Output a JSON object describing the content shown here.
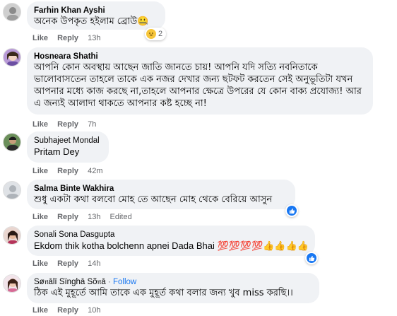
{
  "actions": {
    "like": "Like",
    "reply": "Reply"
  },
  "comments": [
    {
      "author": "Farhin Khan Ayshi",
      "text": "অনেক উপকৃত হইলাম ব্রোউ🤐",
      "time": "13h",
      "reaction_count": "2"
    },
    {
      "author": "Hosneara Shathi",
      "text": "আপনি কোন অবস্থায় আছেন জাতি জানতে চায়! আপনি যদি সত্যি নবনিতাকে ভালোবাসতেন তাহলে তাকে এক নজর দেখার জন্য ছটফট করতেন সেই অনুভূতিটা যখন আপনার মধ্যে কাজ করছে না,তাহলে আপনার ক্ষেত্রে উপরের যে কোন বাক্য প্রযোজ্য! আর এ জন্যই আলাদা থাকতে আপনার কষ্ট হচ্ছে না!",
      "time": "7h"
    },
    {
      "author": "Subhajeet Mondal",
      "text": "Pritam Dey",
      "time": "42m"
    },
    {
      "author": "Salma Binte Wakhira",
      "text": "শুধু একটা কথা বলবো মোহ তে আছেন মোহ থেকে বেরিয়ে আসুন",
      "time": "13h",
      "edited": "Edited"
    },
    {
      "author": "Sonali Sona Dasgupta",
      "text": "Ekdom thik kotha bolchenn apnei Dada Bhai 💯💯💯💯👍👍👍👍",
      "time": "14h"
    },
    {
      "author": "Sø𝔫ālī Sïnghā Sõ𝔫ā",
      "follow": "Follow",
      "text": "ঠিক এই মুহূর্তে আমি তাকে এক মুহূর্ত কথা বলার জন্য খুব miss করছি।।",
      "time": "10h"
    }
  ]
}
